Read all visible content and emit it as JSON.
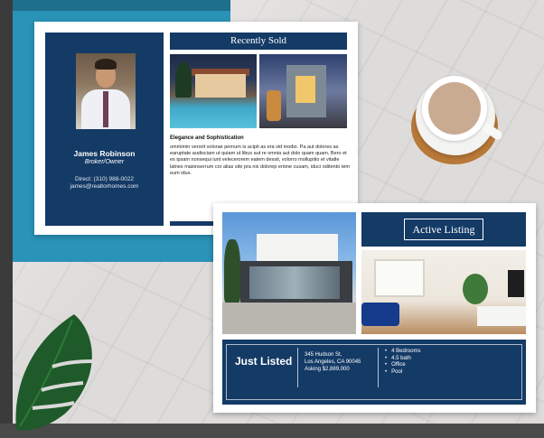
{
  "card_sold": {
    "header": "Recently Sold",
    "agent": {
      "name": "James Robinson",
      "title": "Broker/Owner",
      "phone": "Direct: (310) 988-0022",
      "email": "james@realtorhomes.com"
    },
    "blurb_title": "Elegance and Sophistication",
    "blurb_text": "ommimin verorit volorae pernum is acipit as era vid modio. Pa aut dolores as earuptate audisciam ut quiam ut libus aut re omnia aut dolo quam quam, Bero et es ipsam nonsequi iunt velecerorem eatem dessit, volorro mollupitio et vitatle latnes maionserrum cor alias site pra nis dolorep erione cusam, iduci oditento tem eum idus."
  },
  "card_active": {
    "header": "Active Listing",
    "just_listed": "Just Listed",
    "address_line1": "345 Hudson St,",
    "address_line2": "Los Angeles, CA 90045",
    "asking": "Asking $2,889,000",
    "features": [
      "4 Bedrooms",
      "4.5 bath",
      "Office",
      "Pool"
    ]
  },
  "colors": {
    "navy": "#143a66",
    "accent_blue": "#2a93b8",
    "coaster": "#b87838",
    "coffee": "#c9ab92"
  }
}
